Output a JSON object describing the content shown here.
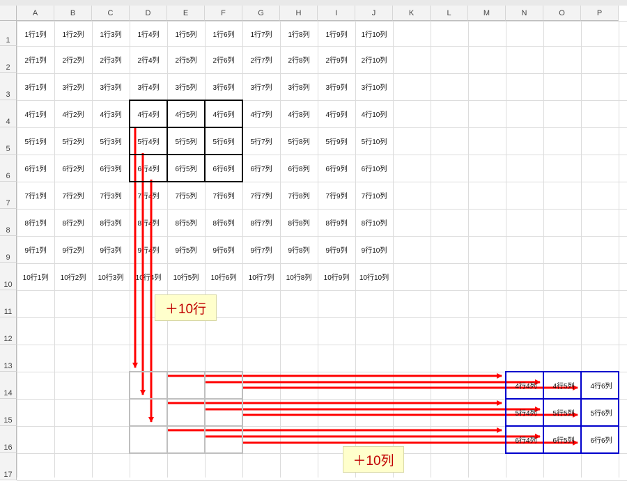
{
  "columns": [
    "A",
    "B",
    "C",
    "D",
    "E",
    "F",
    "G",
    "H",
    "I",
    "J",
    "K",
    "L",
    "M",
    "N",
    "O",
    "P"
  ],
  "rows": [
    "1",
    "2",
    "3",
    "4",
    "5",
    "6",
    "7",
    "8",
    "9",
    "10",
    "11",
    "12",
    "13",
    "14",
    "15",
    "16",
    "17"
  ],
  "cells": [
    [
      "1行1列",
      "1行2列",
      "1行3列",
      "1行4列",
      "1行5列",
      "1行6列",
      "1行7列",
      "1行8列",
      "1行9列",
      "1行10列"
    ],
    [
      "2行1列",
      "2行2列",
      "2行3列",
      "2行4列",
      "2行5列",
      "2行6列",
      "2行7列",
      "2行8列",
      "2行9列",
      "2行10列"
    ],
    [
      "3行1列",
      "3行2列",
      "3行3列",
      "3行4列",
      "3行5列",
      "3行6列",
      "3行7列",
      "3行8列",
      "3行9列",
      "3行10列"
    ],
    [
      "4行1列",
      "4行2列",
      "4行3列",
      "4行4列",
      "4行5列",
      "4行6列",
      "4行7列",
      "4行8列",
      "4行9列",
      "4行10列"
    ],
    [
      "5行1列",
      "5行2列",
      "5行3列",
      "5行4列",
      "5行5列",
      "5行6列",
      "5行7列",
      "5行8列",
      "5行9列",
      "5行10列"
    ],
    [
      "6行1列",
      "6行2列",
      "6行3列",
      "6行4列",
      "6行5列",
      "6行6列",
      "6行7列",
      "6行8列",
      "6行9列",
      "6行10列"
    ],
    [
      "7行1列",
      "7行2列",
      "7行3列",
      "7行4列",
      "7行5列",
      "7行6列",
      "7行7列",
      "7行8列",
      "7行9列",
      "7行10列"
    ],
    [
      "8行1列",
      "8行2列",
      "8行3列",
      "8行4列",
      "8行5列",
      "8行6列",
      "8行7列",
      "8行8列",
      "8行9列",
      "8行10列"
    ],
    [
      "9行1列",
      "9行2列",
      "9行3列",
      "9行4列",
      "9行5列",
      "9行6列",
      "9行7列",
      "9行8列",
      "9行9列",
      "9行10列"
    ],
    [
      "10行1列",
      "10行2列",
      "10行3列",
      "10行4列",
      "10行5列",
      "10行6列",
      "10行7列",
      "10行8列",
      "10行9列",
      "10行10列"
    ]
  ],
  "target_cells": [
    [
      "4行4列",
      "4行5列",
      "4行6列"
    ],
    [
      "5行4列",
      "5行5列",
      "5行6列"
    ],
    [
      "6行4列",
      "6行5列",
      "6行6列"
    ]
  ],
  "annotations": {
    "row_offset_label": "＋10行",
    "col_offset_label": "＋10列"
  },
  "colors": {
    "source_border": "#000000",
    "intermediate_border": "#bfbfbf",
    "target_border": "#0000cc",
    "arrow": "#ff0000",
    "label_bg": "#ffffcc",
    "label_text": "#c00000"
  }
}
